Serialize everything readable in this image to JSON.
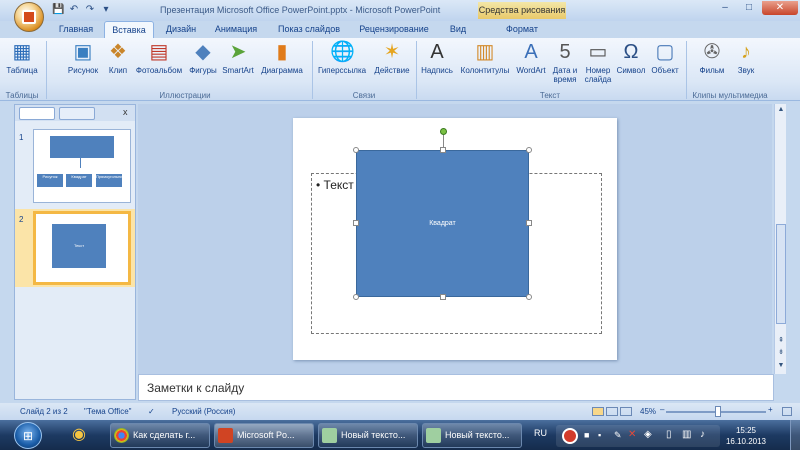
{
  "window": {
    "title": "Презентация Microsoft Office PowerPoint.pptx - Microsoft PowerPoint",
    "context_tab_group": "Средства рисования",
    "minimize": "–",
    "maximize": "□",
    "close": "✕"
  },
  "quick_access": {
    "save": "💾",
    "undo": "↶",
    "redo": "↷",
    "customize": "▾"
  },
  "tabs": [
    "Главная",
    "Вставка",
    "Дизайн",
    "Анимация",
    "Показ слайдов",
    "Рецензирование",
    "Вид",
    "Формат"
  ],
  "active_tab": "Вставка",
  "ribbon": {
    "groups": [
      {
        "label": "Таблицы",
        "buttons": [
          {
            "label": "Таблица",
            "icon": "table-icon"
          }
        ]
      },
      {
        "label": "Иллюстрации",
        "buttons": [
          {
            "label": "Рисунок",
            "icon": "picture-icon"
          },
          {
            "label": "Клип",
            "icon": "clipart-icon"
          },
          {
            "label": "Фотоальбом",
            "icon": "photo-album-icon"
          },
          {
            "label": "Фигуры",
            "icon": "shapes-icon"
          },
          {
            "label": "SmartArt",
            "icon": "smartart-icon"
          },
          {
            "label": "Диаграмма",
            "icon": "chart-icon"
          }
        ]
      },
      {
        "label": "Связи",
        "buttons": [
          {
            "label": "Гиперссылка",
            "icon": "hyperlink-icon"
          },
          {
            "label": "Действие",
            "icon": "action-icon"
          }
        ]
      },
      {
        "label": "Текст",
        "buttons": [
          {
            "label": "Надпись",
            "icon": "textbox-icon"
          },
          {
            "label": "Колонтитулы",
            "icon": "header-footer-icon"
          },
          {
            "label": "WordArt",
            "icon": "wordart-icon"
          },
          {
            "label": "Дата и время",
            "icon": "date-time-icon"
          },
          {
            "label": "Номер слайда",
            "icon": "slide-number-icon"
          },
          {
            "label": "Символ",
            "icon": "symbol-icon"
          },
          {
            "label": "Объект",
            "icon": "object-icon"
          }
        ]
      },
      {
        "label": "Клипы мультимедиа",
        "buttons": [
          {
            "label": "Фильм",
            "icon": "movie-icon"
          },
          {
            "label": "Звук",
            "icon": "sound-icon"
          }
        ]
      }
    ]
  },
  "slides_pane": {
    "slides": [
      {
        "number": "1",
        "labels": [
          "Рисунок",
          "Квадрат",
          "Прямоугольник"
        ]
      },
      {
        "number": "2",
        "labels": [
          "Текст"
        ]
      }
    ],
    "close": "x"
  },
  "slide": {
    "bullet_text": "Текст",
    "shape_text": "Квадрат"
  },
  "notes_placeholder": "Заметки к слайду",
  "status": {
    "slide_info": "Слайд 2 из 2",
    "theme": "\"Тема Office\"",
    "language": "Русский (Россия)",
    "zoom": "45%",
    "zoom_minus": "–",
    "zoom_plus": "+"
  },
  "taskbar": {
    "items": [
      {
        "label": "Как сделать г...",
        "icon": "chrome-icon"
      },
      {
        "label": "Microsoft Po...",
        "icon": "powerpoint-icon"
      },
      {
        "label": "Новый тексто...",
        "icon": "notepad-icon"
      },
      {
        "label": "Новый тексто...",
        "icon": "notepad-icon"
      }
    ],
    "lang": "RU",
    "time": "15:25",
    "date": "16.10.2013"
  },
  "colors": {
    "shape_fill": "#4f81bd",
    "ribbon_bg": "#dbe7f6",
    "selection_border": "#f4b844"
  }
}
